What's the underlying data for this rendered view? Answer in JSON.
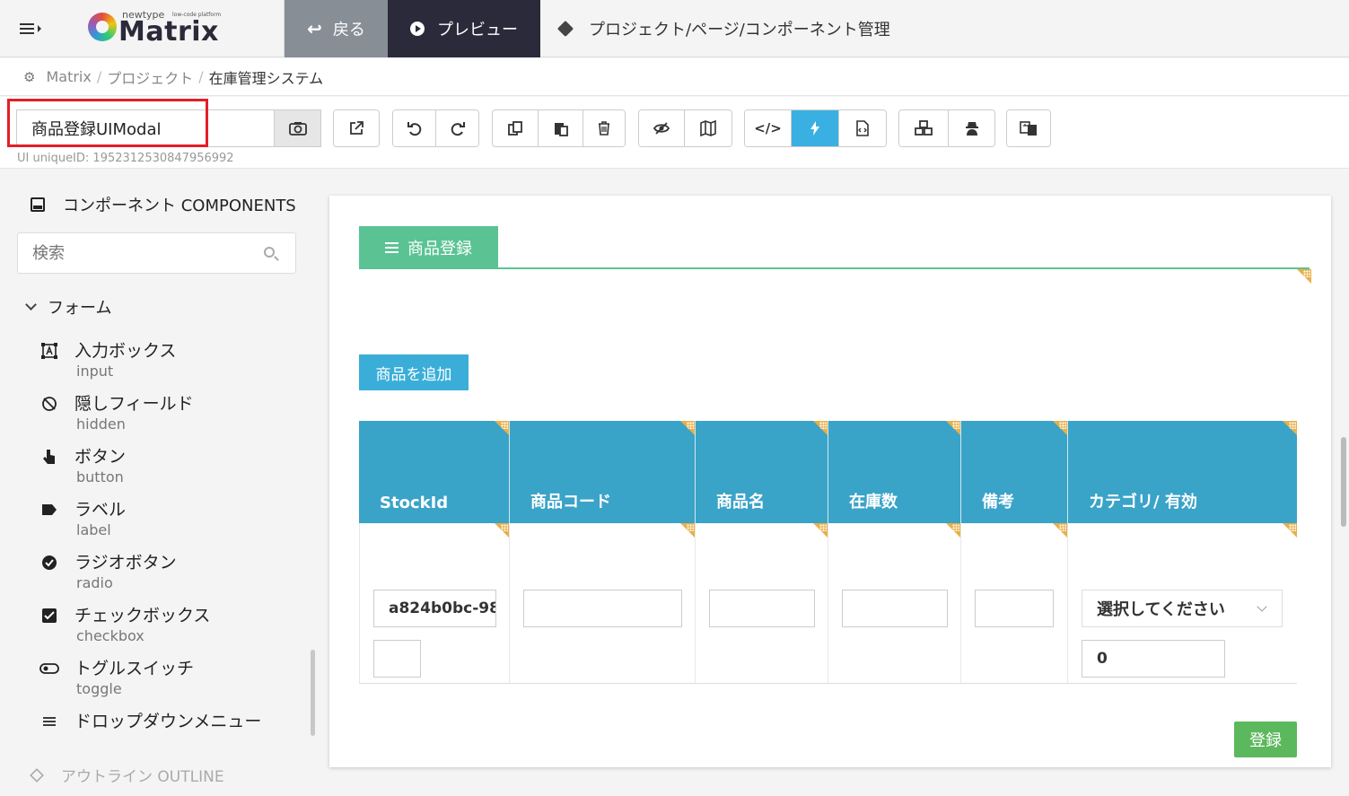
{
  "header": {
    "logo_small": "newtype",
    "logo_tag": "low-code platform",
    "logo_name": "Matrix",
    "back_label": "戻る",
    "preview_label": "プレビュー",
    "nav_title": "プロジェクト/ページ/コンポーネント管理"
  },
  "breadcrumb": {
    "items": [
      "Matrix",
      "プロジェクト",
      "在庫管理システム"
    ]
  },
  "toolbar": {
    "ui_name": "商品登録UIModal",
    "uid_text": "UI uniqueID: 1952312530847956992",
    "active_tool": "lightning"
  },
  "left": {
    "components_header": "コンポーネント COMPONENTS",
    "search_placeholder": "検索",
    "category": "フォーム",
    "items": [
      {
        "jp": "入力ボックス",
        "en": "input",
        "icon": "input-box-icon"
      },
      {
        "jp": "隠しフィールド",
        "en": "hidden",
        "icon": "eye-slash-icon"
      },
      {
        "jp": "ボタン",
        "en": "button",
        "icon": "pointer-hand-icon"
      },
      {
        "jp": "ラベル",
        "en": "label",
        "icon": "tag-icon"
      },
      {
        "jp": "ラジオボタン",
        "en": "radio",
        "icon": "radio-check-icon"
      },
      {
        "jp": "チェックボックス",
        "en": "checkbox",
        "icon": "checkbox-icon"
      },
      {
        "jp": "トグルスイッチ",
        "en": "toggle",
        "icon": "toggle-icon"
      },
      {
        "jp": "ドロップダウンメニュー",
        "en": "",
        "icon": "list-icon"
      }
    ],
    "outline_header": "アウトライン OUTLINE"
  },
  "canvas": {
    "tab_title": "商品登録",
    "add_button": "商品を追加",
    "columns": [
      "StockId",
      "商品コード",
      "商品名",
      "在庫数",
      "備考",
      "カテゴリ/ 有効"
    ],
    "row": {
      "stock_id": "a824b0bc-98",
      "product_code": "",
      "product_name": "",
      "stock_count": "",
      "note": "",
      "category_select": "選択してください",
      "enabled_value": "0"
    },
    "submit_button": "登録"
  },
  "colors": {
    "accent_blue": "#3aa3c8",
    "tab_green": "#5bc393",
    "submit_green": "#5cb85c",
    "dark": "#2a2a3a",
    "highlight_red": "#e41e26"
  }
}
